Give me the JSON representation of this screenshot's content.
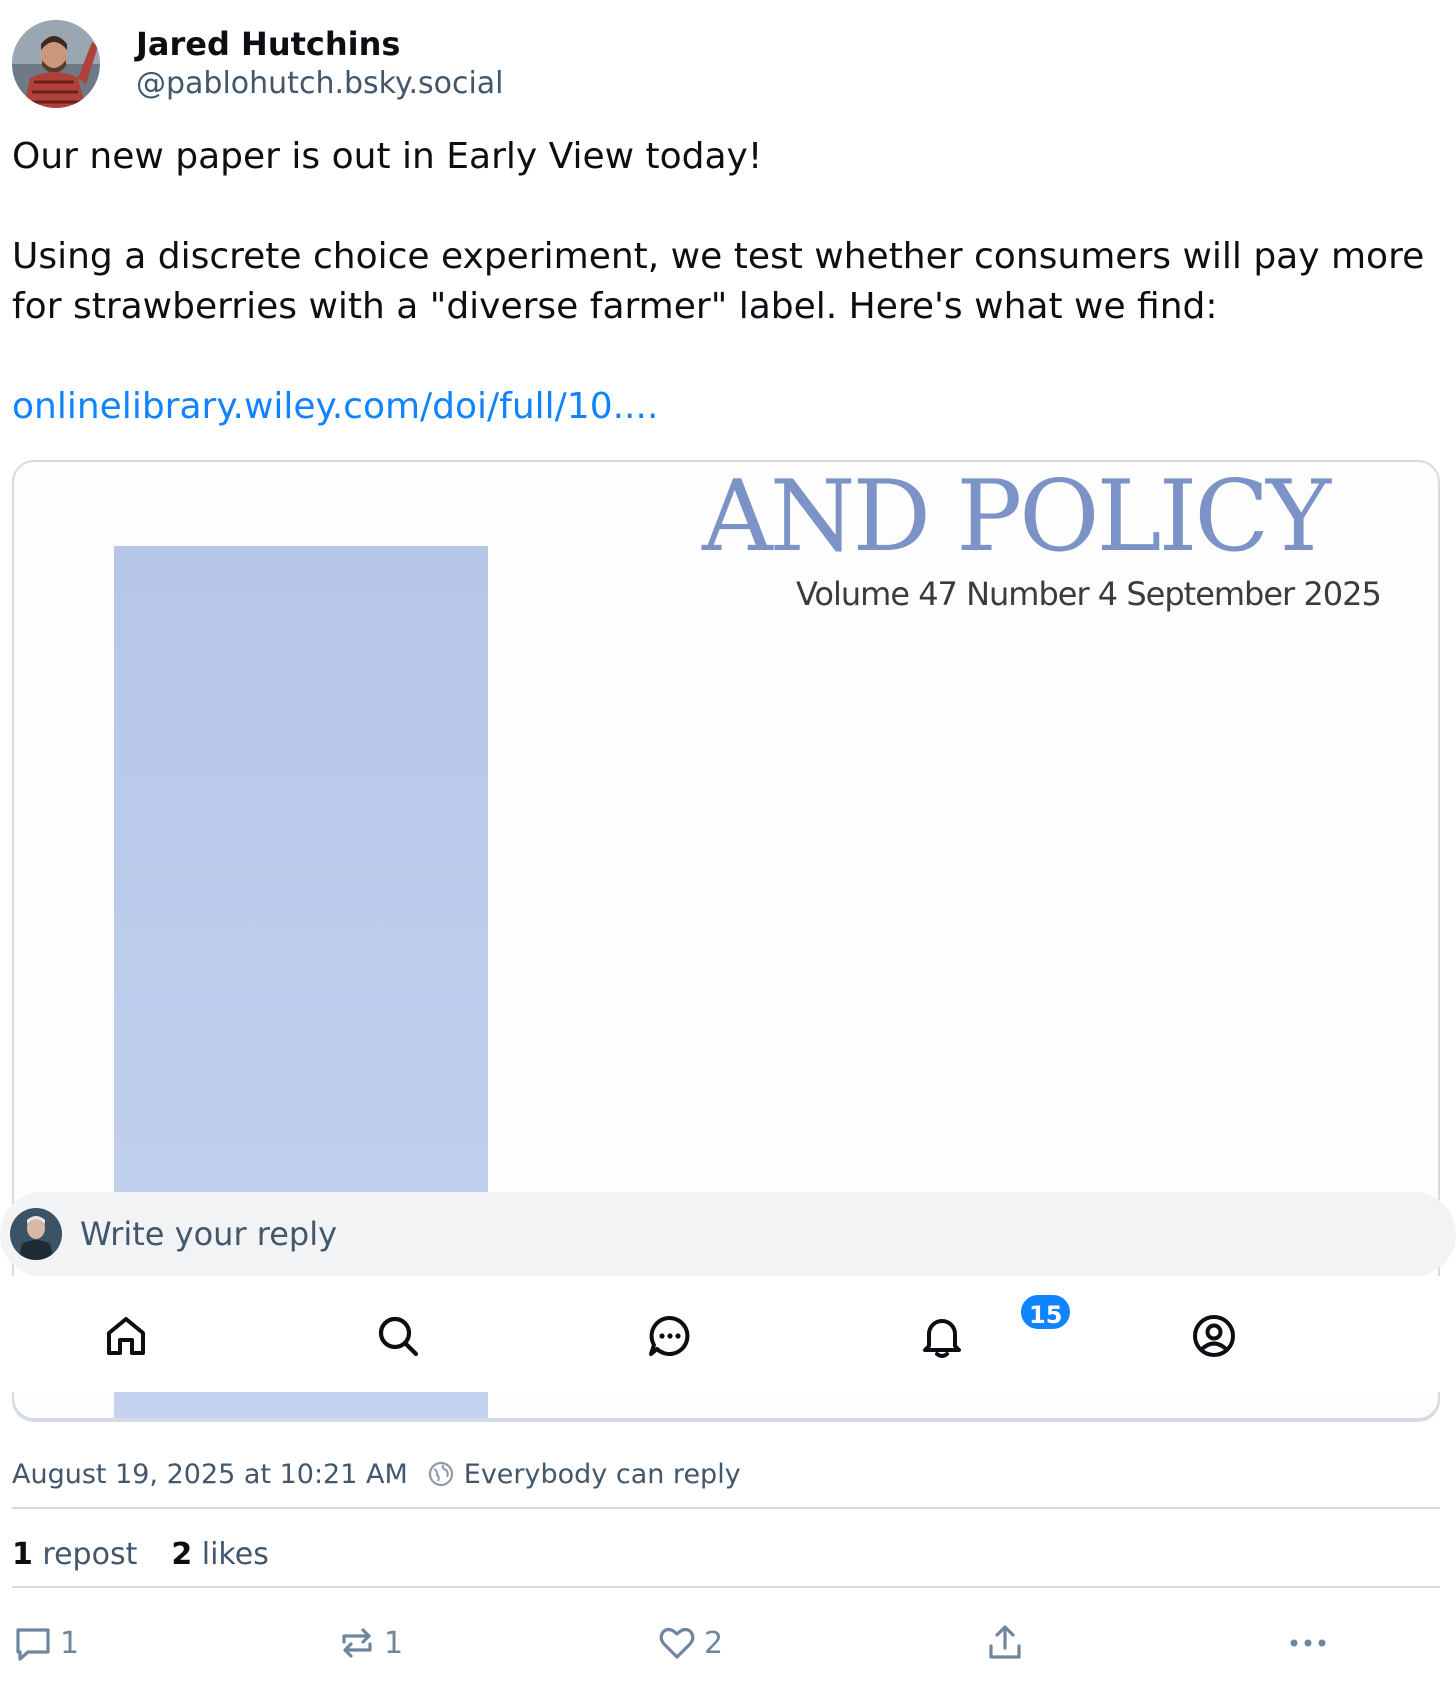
{
  "author": {
    "display_name": "Jared Hutchins",
    "handle": "@pablohutch.bsky.social"
  },
  "post": {
    "line1": "Our new paper is out in Early View today!",
    "line2": "Using a discrete choice experiment, we test whether consumers will pay more for strawberries with a \"diverse farmer\" label. Here's what we find:",
    "link_text": "onlinelibrary.wiley.com/doi/full/10...."
  },
  "embed": {
    "journal_title": "AND POLICY",
    "issue": "Volume 47  Number 4 September 2025"
  },
  "reply": {
    "placeholder": "Write your reply"
  },
  "nav": {
    "notifications_badge": "15",
    "items": [
      "home-icon",
      "search-icon",
      "chat-icon",
      "bell-icon",
      "profile-icon"
    ]
  },
  "meta": {
    "timestamp": "August 19, 2025 at 10:21 AM",
    "reply_setting": "Everybody can reply"
  },
  "stats": {
    "reposts_count": "1",
    "reposts_label": "repost",
    "likes_count": "2",
    "likes_label": "likes"
  },
  "actions": {
    "reply_count": "1",
    "repost_count": "1",
    "like_count": "2"
  },
  "colors": {
    "accent": "#1083fe",
    "muted_text": "#42576c",
    "border": "#d4dbe2",
    "journal_blue": "#7c93c8"
  }
}
